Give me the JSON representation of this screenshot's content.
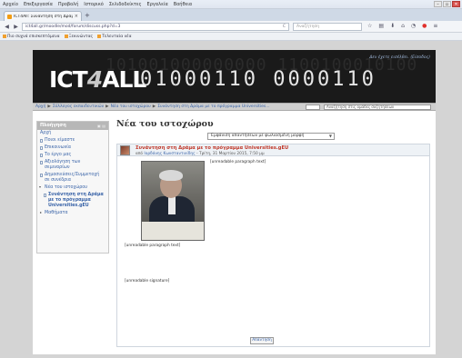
{
  "browser": {
    "menu": [
      "Αρχείο",
      "Επεξεργασία",
      "Προβολή",
      "Ιστορικό",
      "Σελιδοδείκτες",
      "Εργαλεία",
      "Βοήθεια"
    ],
    "tab_title": "ICT4All: Συνάντηση στη Δράμα...",
    "url": "ict4all.gr/moodle/mod/forum/discuss.php?d=3",
    "url_right": "C",
    "search_placeholder": "Αναζήτηση",
    "bookmarks": [
      "Πιο συχνά επισκεπτόμενα",
      "Ξεκινώντας",
      "Τελευταία νέα"
    ]
  },
  "site": {
    "logo_text": "ICT",
    "logo_four": "4",
    "logo_rest": "ALL",
    "binary_back": "101001000000000 1100100010100",
    "binary_front": "01000110 0000110",
    "login_text": "Δεν έχετε εισέλθει. (Είσοδος)"
  },
  "breadcrumb": {
    "items": [
      "Αρχή",
      "Σύλλογος εκπαιδευτικών",
      "Νέα του ιστοχώρου",
      "Συνάντηση στη Δράμα με το πρόγραμμα Universities..."
    ],
    "search_placeholder": "Αναζήτηση στις ομάδες συζητήσεων"
  },
  "sidebar": {
    "heading": "Πλοήγηση",
    "items": [
      {
        "label": "Αρχή",
        "kind": "root"
      },
      {
        "label": "Ποιοι είμαστε",
        "kind": "doc"
      },
      {
        "label": "Επικοινωνία",
        "kind": "doc"
      },
      {
        "label": "Το έργο μας",
        "kind": "doc"
      },
      {
        "label": "Αξιολόγηση των σεμιναρίων",
        "kind": "doc"
      },
      {
        "label": "Δημοσιεύσεις/Συμμετοχή σε συνέδρια",
        "kind": "doc"
      },
      {
        "label": "Νέα του ιστοχώρου",
        "kind": "open"
      },
      {
        "label": "Συνάντηση στη Δράμα με το πρόγραμμα Universities.gEU",
        "kind": "active"
      },
      {
        "label": "Μαθήματα",
        "kind": "sub"
      }
    ]
  },
  "main": {
    "title": "Νέα του ιστοχώρου",
    "display_select": "Εμφάνιση απαντήσεων με φωλιασμένη μορφή",
    "post_subject": "Συνάντηση στη Δράμα με το πρόγραμμα Universities.gEU",
    "post_by_prefix": "από ",
    "post_author": "Ιορδάνης Κωνσταντινίδης",
    "post_date": " - Τρίτη, 31 Μαρτίου 2015, 7:50 μμ",
    "paragraph1": "[unreadable paragraph text]",
    "paragraph2": "[unreadable paragraph text]",
    "signature": "[unreadable signature]",
    "reply_label": "Απάντηση"
  }
}
